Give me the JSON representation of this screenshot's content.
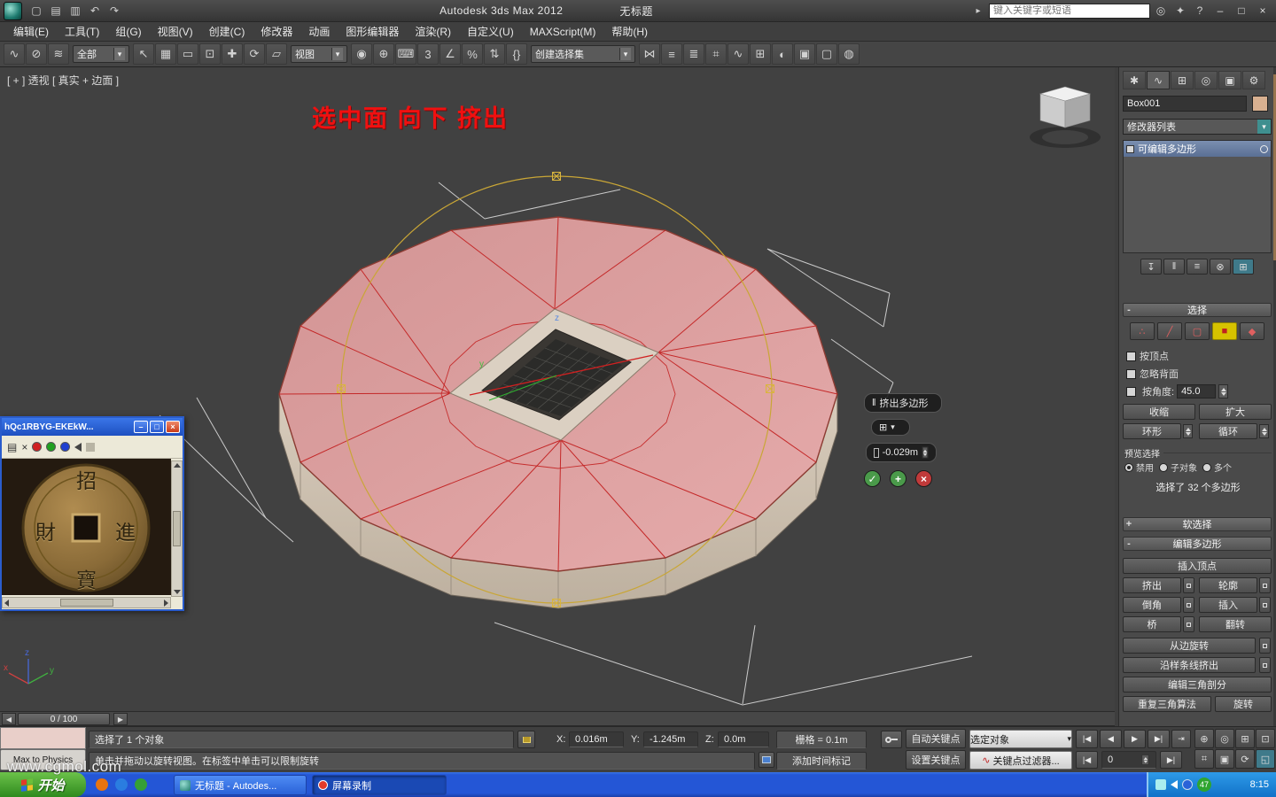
{
  "titlebar": {
    "app_title": "Autodesk 3ds Max  2012",
    "doc_title": "无标题",
    "search_placeholder": "键入关键字或短语",
    "search_arrow": "▸",
    "icons": [
      "▢",
      "▤",
      "▥",
      "↶",
      "↷"
    ],
    "right_icons": [
      "◎",
      "✦",
      "?"
    ],
    "window_controls": [
      "–",
      "□",
      "×"
    ]
  },
  "menus": [
    "编辑(E)",
    "工具(T)",
    "组(G)",
    "视图(V)",
    "创建(C)",
    "修改器",
    "动画",
    "图形编辑器",
    "渲染(R)",
    "自定义(U)",
    "MAXScript(M)",
    "帮助(H)"
  ],
  "toolbar": {
    "icons": [
      "∿",
      "⊘",
      "≋",
      "↖",
      "▦",
      "▭",
      "⊡",
      "✚",
      "⟳",
      "▱",
      "◉",
      "⊕",
      "⌨",
      "3",
      "∠",
      "%",
      "⇅",
      "{}",
      "⋈",
      "≡",
      "≣",
      "⌗",
      "∿",
      "⊞",
      "◐",
      "▣",
      "▢",
      "◍"
    ],
    "filter_value": "全部",
    "coord_value": "视图",
    "sets_value": "创建选择集",
    "dd_arrow": "▾"
  },
  "viewport": {
    "label": "[ + ] 透视 [ 真实 + 边面 ]",
    "annotation": "选中面 向下 挤出",
    "axis": {
      "x": "x",
      "y": "y",
      "z": "z"
    }
  },
  "caddy": {
    "handle_icon": "‖",
    "title": "挤出多边形",
    "group_icon": "⊞",
    "dropdown_arrow": "▾",
    "amount": "-0.029m",
    "ok": "✓",
    "apply": "+",
    "cancel": "×"
  },
  "time_slider": {
    "value": "0 / 100",
    "left_arrow": "◀",
    "right_arrow": "▶"
  },
  "panel": {
    "tabs": [
      "✱",
      "∿",
      "⊞",
      "◎",
      "▣",
      "⚙"
    ],
    "object_name": "Box001",
    "modifier_list": "修改器列表",
    "dd_arrow": "▾",
    "stack_item": "可编辑多边形",
    "stack_icons": [
      "↧",
      "‖",
      "≡",
      "⊗",
      "⊞"
    ],
    "subobj_icons": [
      "∴",
      "╱",
      "▢",
      "■",
      "◆"
    ],
    "collapse_glyph": "-",
    "expand_glyph": "+",
    "sel": {
      "title": "选择",
      "by_vertex": "按顶点",
      "ignore_backfacing": "忽略背面",
      "by_angle": "按角度:",
      "angle_value": "45.0",
      "shrink": "收缩",
      "grow": "扩大",
      "ring": "环形",
      "loop": "循环",
      "preview_label": "预览选择",
      "preview_disable": "禁用",
      "preview_subobj": "子对象",
      "preview_multi": "多个",
      "status": "选择了 32 个多边形"
    },
    "soft_sel_title": "软选择",
    "edit_poly_title": "编辑多边形",
    "buttons": {
      "insert_vertex": "插入顶点",
      "extrude": "挤出",
      "outline": "轮廓",
      "bevel": "倒角",
      "inset": "插入",
      "bridge": "桥",
      "flip": "翻转",
      "hinge": "从边旋转",
      "spline_extrude": "沿样条线挤出",
      "edit_tri": "编辑三角剖分",
      "retriangulate": "重复三角算法",
      "turn": "旋转"
    }
  },
  "image_window": {
    "title": "hQc1RBYG-EKEkW...",
    "controls": [
      "–",
      "□",
      "×"
    ],
    "tool_icons": [
      "▤",
      "×"
    ],
    "coin": {
      "top": "招",
      "left": "財",
      "right": "進",
      "bottom": "寶"
    }
  },
  "status": {
    "selection": "选择了 1 个对象",
    "prompt": "单击并拖动以旋转视图。在标签中单击可以限制旋转",
    "x_label": "X:",
    "x": "0.016m",
    "y_label": "Y:",
    "y": "-1.245m",
    "z_label": "Z:",
    "z": "0.0m",
    "grid": "栅格 = 0.1m",
    "time_tag": "添加时间标记",
    "auto_key": "自动关键点",
    "set_key": "设置关键点",
    "sel_filter": "选定对象",
    "dd_arrow": "▾",
    "key_filters": "关键点过滤器...",
    "curve_icon": "∿",
    "frame": "0",
    "playback": [
      "|◀",
      "◀",
      "▶",
      "▶|",
      "⇥"
    ],
    "nav_icons": [
      "⊕",
      "◎",
      "⊞",
      "⊡",
      "⌗",
      "▣",
      "⟳",
      "◱"
    ]
  },
  "misc": {
    "max_to_physics": "Max to Physics",
    "watermark": "www.cgmol.com"
  },
  "taskbar": {
    "start": "开始",
    "task1": "无标题 - Autodes...",
    "task2": "屏幕录制",
    "badge": "47",
    "clock": "8:15"
  }
}
